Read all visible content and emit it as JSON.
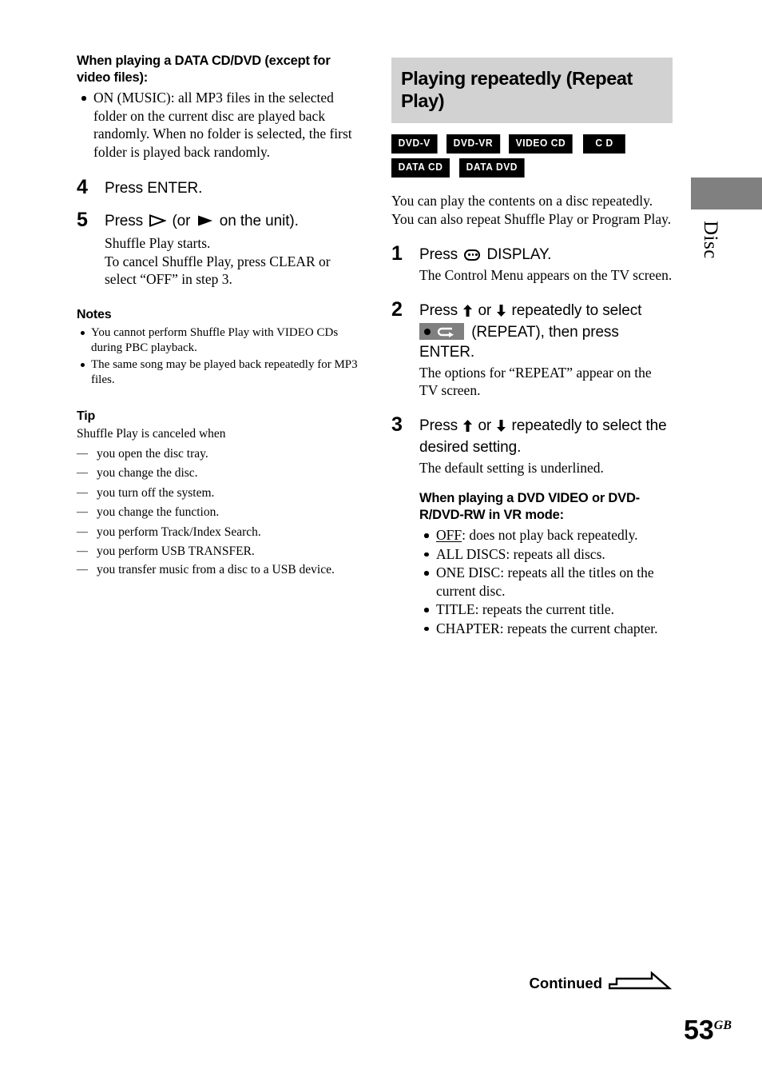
{
  "left_column": {
    "heading": "When playing a DATA CD/DVD (except for video files):",
    "heading_bullets": [
      "ON (MUSIC): all MP3 files in the selected folder on the current disc are played back randomly. When no folder is selected, the first folder is played back randomly."
    ],
    "steps": [
      {
        "number": "4",
        "head_text": "Press ENTER.",
        "desc": ""
      },
      {
        "number": "5",
        "head_prefix": "Press",
        "head_middle": "(or",
        "head_suffix": "on the unit).",
        "desc": "Shuffle Play starts.\nTo cancel Shuffle Play, press CLEAR or select “OFF” in step 3."
      }
    ],
    "notes_title": "Notes",
    "notes": [
      "You cannot perform Shuffle Play with VIDEO CDs during PBC playback.",
      "The same song may be played back repeatedly for MP3 files."
    ],
    "tip_title": "Tip",
    "tip_intro": "Shuffle Play is canceled when",
    "tip_items": [
      "you open the disc tray.",
      "you change the disc.",
      "you turn off the system.",
      "you change the function.",
      "you perform Track/Index Search.",
      "you perform USB TRANSFER.",
      "you transfer music from a disc to a USB device."
    ]
  },
  "right_column": {
    "title": "Playing repeatedly (Repeat Play)",
    "title_bg": "#d2d2d2",
    "badges": [
      "DVD-V",
      "DVD-VR",
      "VIDEO CD",
      "C D",
      "DATA CD",
      "DATA DVD"
    ],
    "intro": "You can play the contents on a disc repeatedly.\nYou can also repeat Shuffle Play or Program Play.",
    "steps": [
      {
        "number": "1",
        "head_prefix": "Press",
        "head_suffix": "DISPLAY.",
        "desc": "The Control Menu appears on the TV screen."
      },
      {
        "number": "2",
        "head_part1": "Press",
        "head_or": "or",
        "head_part2": "repeatedly to select",
        "head_part3": "(REPEAT), then press ENTER.",
        "desc": "The options for “REPEAT” appear on the TV screen."
      },
      {
        "number": "3",
        "head_part1": "Press",
        "head_or": "or",
        "head_part2": "repeatedly to select the desired setting.",
        "desc": "The default setting is underlined."
      }
    ],
    "setting_heading": "When playing a DVD VIDEO or DVD-R/DVD-RW in VR mode:",
    "settings": [
      {
        "name": "OFF",
        "underlined": true,
        "text": ": does not play back repeatedly."
      },
      {
        "name": "ALL DISCS",
        "underlined": false,
        "text": ": repeats all discs."
      },
      {
        "name": "ONE DISC",
        "underlined": false,
        "text": ": repeats all the titles on the current disc."
      },
      {
        "name": "TITLE",
        "underlined": false,
        "text": ": repeats the current title."
      },
      {
        "name": "CHAPTER",
        "underlined": false,
        "text": ": repeats the current chapter."
      }
    ]
  },
  "side_tab": {
    "label": "Disc",
    "color": "#808080"
  },
  "footer": {
    "continued": "Continued",
    "page_number": "53",
    "page_suffix": "GB"
  },
  "icons": {
    "display": "display-icon",
    "repeat": "repeat-icon",
    "play_hollow": "play-triangle-hollow-icon",
    "play_solid": "play-triangle-solid-icon",
    "arrow_up": "arrow-up-icon",
    "arrow_down": "arrow-down-icon",
    "continued_arrow": "continued-arrow-icon"
  }
}
